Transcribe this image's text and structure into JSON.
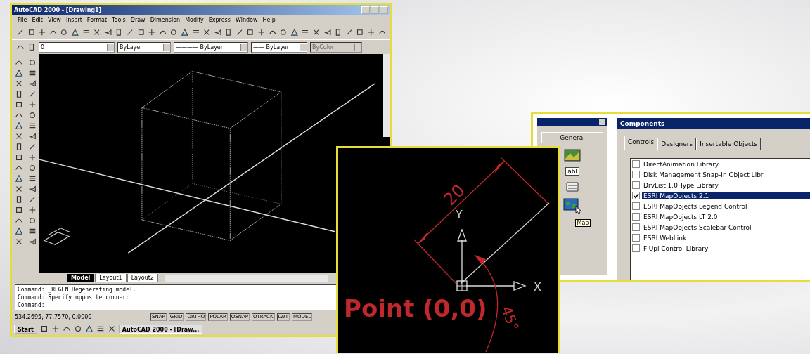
{
  "cad_window": {
    "title": "AutoCAD 2000 - [Drawing1]",
    "menu": [
      "File",
      "Edit",
      "View",
      "Insert",
      "Format",
      "Tools",
      "Draw",
      "Dimension",
      "Modify",
      "Express",
      "Window",
      "Help"
    ],
    "property_dropdowns": [
      {
        "value": "0",
        "disabled": false
      },
      {
        "value": "ByLayer",
        "disabled": false
      },
      {
        "value": "———— ByLayer",
        "disabled": false
      },
      {
        "value": "—— ByLayer",
        "disabled": false
      },
      {
        "value": "ByColor",
        "disabled": true
      }
    ],
    "layout_tabs": [
      {
        "label": "Model",
        "selected": true
      },
      {
        "label": "Layout1",
        "selected": false
      },
      {
        "label": "Layout2",
        "selected": false
      }
    ],
    "command_lines": [
      "Command: _REGEN Regenerating model.",
      "Command: Specify opposite corner:",
      "Command:"
    ],
    "coordinates": "534.2695, 77.7570, 0.0000",
    "status_toggles": [
      "SNAP",
      "GRID",
      "ORTHO",
      "POLAR",
      "OSNAP",
      "OTRACK",
      "LWT",
      "MODEL"
    ],
    "taskbar": {
      "start": "Start",
      "tasks": [
        "AutoCAD 2000 - [Draw..."
      ]
    }
  },
  "detail_view": {
    "dimension": "20",
    "y_axis": "Y",
    "x_axis": "X",
    "angle": "45°",
    "caption": "Point (0,0)"
  },
  "toolbox": {
    "tab": "General",
    "control_label": "abl",
    "tooltip": "Map"
  },
  "components_dialog": {
    "title": "Components",
    "tabs": [
      {
        "label": "Controls",
        "selected": true
      },
      {
        "label": "Designers",
        "selected": false
      },
      {
        "label": "Insertable Objects",
        "selected": false
      }
    ],
    "items": [
      {
        "label": "DirectAnimation Library",
        "checked": false,
        "selected": false
      },
      {
        "label": "Disk Management Snap-In Object Libr",
        "checked": false,
        "selected": false
      },
      {
        "label": "DrvList 1.0 Type Library",
        "checked": false,
        "selected": false
      },
      {
        "label": "ESRI MapObjects 2.1",
        "checked": true,
        "selected": true
      },
      {
        "label": "ESRI MapObjects Legend Control",
        "checked": false,
        "selected": false
      },
      {
        "label": "ESRI MapObjects LT 2.0",
        "checked": false,
        "selected": false
      },
      {
        "label": "ESRI MapObjects Scalebar Control",
        "checked": false,
        "selected": false
      },
      {
        "label": "ESRI WebLink",
        "checked": false,
        "selected": false
      },
      {
        "label": "FlUpl Control Library",
        "checked": false,
        "selected": false
      }
    ]
  }
}
